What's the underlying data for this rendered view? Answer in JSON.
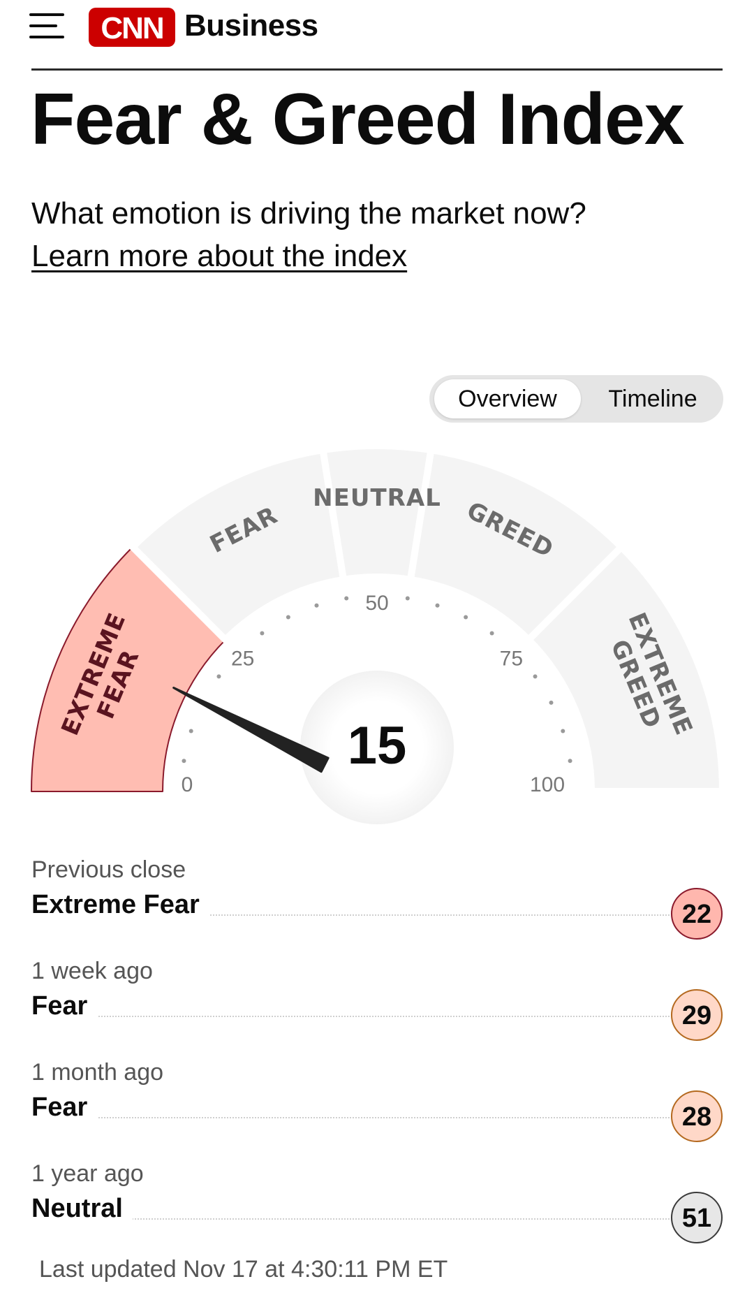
{
  "header": {
    "brand": "Business",
    "logo_text": "CNN"
  },
  "page": {
    "title": "Fear & Greed Index",
    "subtitle": "What emotion is driving the market now?",
    "learn_more": "Learn more about the index"
  },
  "view_toggle": {
    "options": [
      "Overview",
      "Timeline"
    ],
    "selected": "Overview"
  },
  "gauge": {
    "value": 15,
    "min": 0,
    "max": 100,
    "ticks": [
      "0",
      "25",
      "50",
      "75",
      "100"
    ],
    "sections": [
      {
        "label_lines": [
          "EXTREME",
          "FEAR"
        ],
        "from": 0,
        "to": 25,
        "active": true
      },
      {
        "label_lines": [
          "FEAR"
        ],
        "from": 25,
        "to": 45,
        "active": false
      },
      {
        "label_lines": [
          "NEUTRAL"
        ],
        "from": 45,
        "to": 55,
        "active": false
      },
      {
        "label_lines": [
          "GREED"
        ],
        "from": 55,
        "to": 75,
        "active": false
      },
      {
        "label_lines": [
          "EXTREME",
          "GREED"
        ],
        "from": 75,
        "to": 100,
        "active": false
      }
    ],
    "colors": {
      "active_fill": "#ffbdb2",
      "active_stroke": "#8a1a2c",
      "inactive_fill": "#f4f4f4",
      "label": "#6b6b6b",
      "needle": "#222222"
    }
  },
  "history": [
    {
      "label": "Previous close",
      "rating": "Extreme Fear",
      "value": "22",
      "tone": "extreme-fear"
    },
    {
      "label": "1 week ago",
      "rating": "Fear",
      "value": "29",
      "tone": "fear"
    },
    {
      "label": "1 month ago",
      "rating": "Fear",
      "value": "28",
      "tone": "fear"
    },
    {
      "label": "1 year ago",
      "rating": "Neutral",
      "value": "51",
      "tone": "neutral"
    }
  ],
  "last_updated": "Last updated Nov 17 at 4:30:11 PM ET",
  "colors": {
    "brand_red": "#cc0000"
  }
}
